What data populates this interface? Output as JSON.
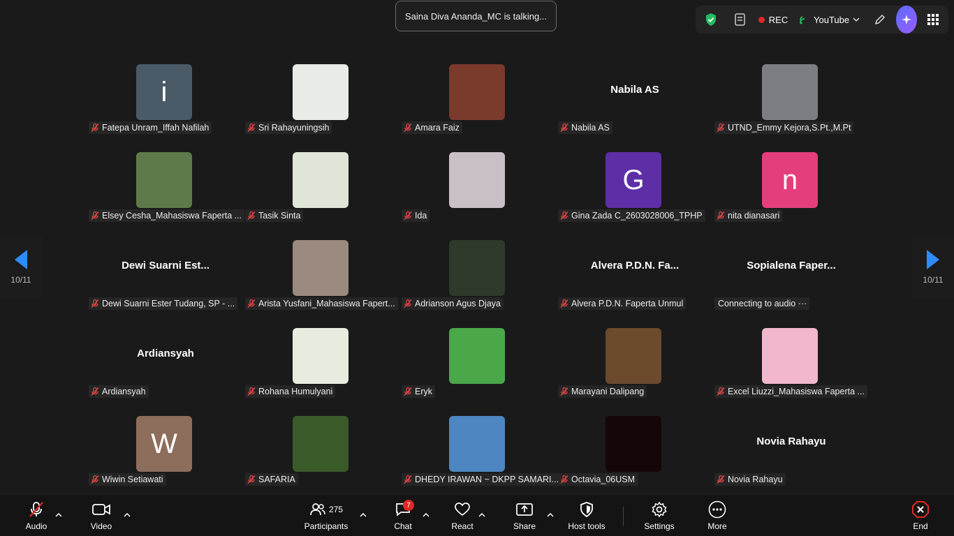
{
  "talking_banner": "Saina Diva Ananda_MC is talking...",
  "topbar": {
    "rec_label": "REC",
    "stream_label": "YouTube"
  },
  "pager": {
    "left_label": "10/11",
    "right_label": "10/11"
  },
  "tiles": [
    {
      "name": "Fatepa Unram_Iffah Nafilah",
      "letter": "i",
      "bg": "#4a5a66"
    },
    {
      "name": "Sri Rahayuningsih",
      "bg": "#e9ece6"
    },
    {
      "name": "Amara Faiz",
      "bg": "#7a3a2c"
    },
    {
      "name": "Nabila AS",
      "big": "Nabila AS"
    },
    {
      "name": "UTND_Emmy Kejora,S.Pt.,M.Pt",
      "bg": "#7c7e84"
    },
    {
      "name": "Elsey Cesha_Mahasiswa Faperta ...",
      "bg": "#5f7a4a"
    },
    {
      "name": "Tasik Sinta",
      "bg": "#dfe6d8"
    },
    {
      "name": "Ida",
      "bg": "#c9bfc7"
    },
    {
      "name": "Gina Zada C_2603028006_TPHP",
      "letter": "G",
      "bg": "#5e2ea6"
    },
    {
      "name": "nita dianasari",
      "letter": "n",
      "bg": "#e53e7c"
    },
    {
      "name": "Dewi Suarni Ester Tudang, SP - ...",
      "big": "Dewi Suarni  Est..."
    },
    {
      "name": "Arista Yusfani_Mahasiswa Fapert...",
      "bg": "#9a8a7f"
    },
    {
      "name": "Adrianson Agus Djaya",
      "bg": "#2f3a2b"
    },
    {
      "name": "Alvera P.D.N. Faperta Unmul",
      "big": "Alvera P.D.N. Fa..."
    },
    {
      "name": "Connecting to audio ···",
      "big": "Sopialena  Faper...",
      "nomute": true
    },
    {
      "name": "Ardiansyah",
      "big": "Ardiansyah"
    },
    {
      "name": "Rohana Humulyani",
      "bg": "#e8ecdf"
    },
    {
      "name": "Eryk",
      "bg": "#4aa84a"
    },
    {
      "name": "Marayani Dalipang",
      "bg": "#6b4a2e"
    },
    {
      "name": "Excel Liuzzi_Mahasiswa Faperta ...",
      "bg": "#f1b7cf"
    },
    {
      "name": "Wiwin Setiawati",
      "letter": "W",
      "bg": "#8d6e5c"
    },
    {
      "name": "SAFARIA",
      "bg": "#3b5a2a"
    },
    {
      "name": "DHEDY IRAWAN ~ DKPP SAMARI...",
      "bg": "#4d86c0"
    },
    {
      "name": "Octavia_06USM",
      "bg": "#150608"
    },
    {
      "name": "Novia Rahayu",
      "big": "Novia Rahayu"
    }
  ],
  "toolbar": {
    "audio": "Audio",
    "video": "Video",
    "participants": "Participants",
    "participants_count": "275",
    "chat": "Chat",
    "chat_badge": "7",
    "react": "React",
    "share": "Share",
    "host_tools": "Host tools",
    "settings": "Settings",
    "more": "More",
    "end": "End"
  },
  "colors": {
    "accent_red": "#e02828",
    "shield_green": "#1fbf5f",
    "nav_blue": "#2d8cff"
  }
}
